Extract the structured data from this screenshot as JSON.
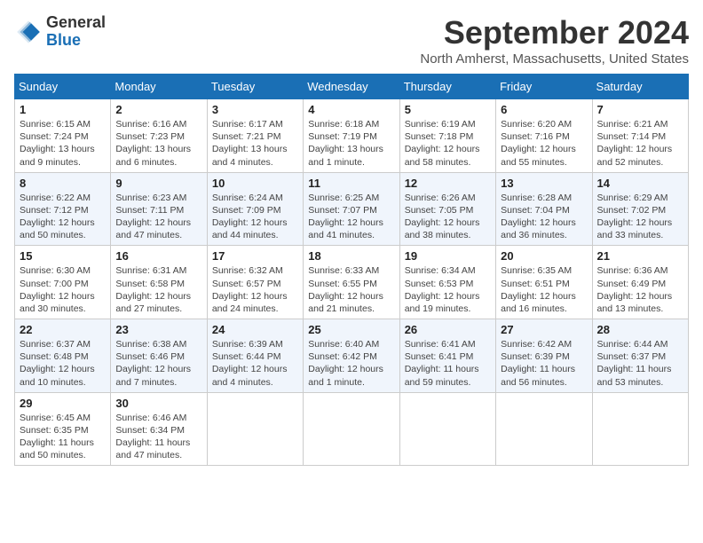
{
  "header": {
    "logo_line1": "General",
    "logo_line2": "Blue",
    "month": "September 2024",
    "location": "North Amherst, Massachusetts, United States"
  },
  "days_of_week": [
    "Sunday",
    "Monday",
    "Tuesday",
    "Wednesday",
    "Thursday",
    "Friday",
    "Saturday"
  ],
  "weeks": [
    [
      {
        "day": "1",
        "info": "Sunrise: 6:15 AM\nSunset: 7:24 PM\nDaylight: 13 hours\nand 9 minutes."
      },
      {
        "day": "2",
        "info": "Sunrise: 6:16 AM\nSunset: 7:23 PM\nDaylight: 13 hours\nand 6 minutes."
      },
      {
        "day": "3",
        "info": "Sunrise: 6:17 AM\nSunset: 7:21 PM\nDaylight: 13 hours\nand 4 minutes."
      },
      {
        "day": "4",
        "info": "Sunrise: 6:18 AM\nSunset: 7:19 PM\nDaylight: 13 hours\nand 1 minute."
      },
      {
        "day": "5",
        "info": "Sunrise: 6:19 AM\nSunset: 7:18 PM\nDaylight: 12 hours\nand 58 minutes."
      },
      {
        "day": "6",
        "info": "Sunrise: 6:20 AM\nSunset: 7:16 PM\nDaylight: 12 hours\nand 55 minutes."
      },
      {
        "day": "7",
        "info": "Sunrise: 6:21 AM\nSunset: 7:14 PM\nDaylight: 12 hours\nand 52 minutes."
      }
    ],
    [
      {
        "day": "8",
        "info": "Sunrise: 6:22 AM\nSunset: 7:12 PM\nDaylight: 12 hours\nand 50 minutes."
      },
      {
        "day": "9",
        "info": "Sunrise: 6:23 AM\nSunset: 7:11 PM\nDaylight: 12 hours\nand 47 minutes."
      },
      {
        "day": "10",
        "info": "Sunrise: 6:24 AM\nSunset: 7:09 PM\nDaylight: 12 hours\nand 44 minutes."
      },
      {
        "day": "11",
        "info": "Sunrise: 6:25 AM\nSunset: 7:07 PM\nDaylight: 12 hours\nand 41 minutes."
      },
      {
        "day": "12",
        "info": "Sunrise: 6:26 AM\nSunset: 7:05 PM\nDaylight: 12 hours\nand 38 minutes."
      },
      {
        "day": "13",
        "info": "Sunrise: 6:28 AM\nSunset: 7:04 PM\nDaylight: 12 hours\nand 36 minutes."
      },
      {
        "day": "14",
        "info": "Sunrise: 6:29 AM\nSunset: 7:02 PM\nDaylight: 12 hours\nand 33 minutes."
      }
    ],
    [
      {
        "day": "15",
        "info": "Sunrise: 6:30 AM\nSunset: 7:00 PM\nDaylight: 12 hours\nand 30 minutes."
      },
      {
        "day": "16",
        "info": "Sunrise: 6:31 AM\nSunset: 6:58 PM\nDaylight: 12 hours\nand 27 minutes."
      },
      {
        "day": "17",
        "info": "Sunrise: 6:32 AM\nSunset: 6:57 PM\nDaylight: 12 hours\nand 24 minutes."
      },
      {
        "day": "18",
        "info": "Sunrise: 6:33 AM\nSunset: 6:55 PM\nDaylight: 12 hours\nand 21 minutes."
      },
      {
        "day": "19",
        "info": "Sunrise: 6:34 AM\nSunset: 6:53 PM\nDaylight: 12 hours\nand 19 minutes."
      },
      {
        "day": "20",
        "info": "Sunrise: 6:35 AM\nSunset: 6:51 PM\nDaylight: 12 hours\nand 16 minutes."
      },
      {
        "day": "21",
        "info": "Sunrise: 6:36 AM\nSunset: 6:49 PM\nDaylight: 12 hours\nand 13 minutes."
      }
    ],
    [
      {
        "day": "22",
        "info": "Sunrise: 6:37 AM\nSunset: 6:48 PM\nDaylight: 12 hours\nand 10 minutes."
      },
      {
        "day": "23",
        "info": "Sunrise: 6:38 AM\nSunset: 6:46 PM\nDaylight: 12 hours\nand 7 minutes."
      },
      {
        "day": "24",
        "info": "Sunrise: 6:39 AM\nSunset: 6:44 PM\nDaylight: 12 hours\nand 4 minutes."
      },
      {
        "day": "25",
        "info": "Sunrise: 6:40 AM\nSunset: 6:42 PM\nDaylight: 12 hours\nand 1 minute."
      },
      {
        "day": "26",
        "info": "Sunrise: 6:41 AM\nSunset: 6:41 PM\nDaylight: 11 hours\nand 59 minutes."
      },
      {
        "day": "27",
        "info": "Sunrise: 6:42 AM\nSunset: 6:39 PM\nDaylight: 11 hours\nand 56 minutes."
      },
      {
        "day": "28",
        "info": "Sunrise: 6:44 AM\nSunset: 6:37 PM\nDaylight: 11 hours\nand 53 minutes."
      }
    ],
    [
      {
        "day": "29",
        "info": "Sunrise: 6:45 AM\nSunset: 6:35 PM\nDaylight: 11 hours\nand 50 minutes."
      },
      {
        "day": "30",
        "info": "Sunrise: 6:46 AM\nSunset: 6:34 PM\nDaylight: 11 hours\nand 47 minutes."
      },
      null,
      null,
      null,
      null,
      null
    ]
  ]
}
